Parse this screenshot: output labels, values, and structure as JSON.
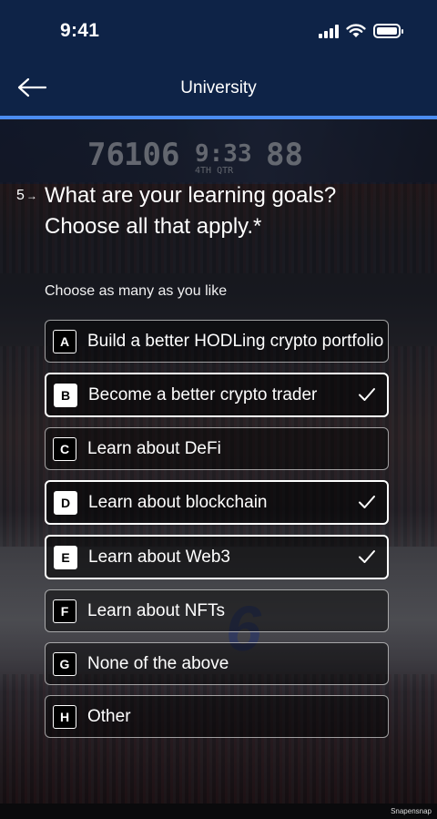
{
  "status_bar": {
    "time": "9:41"
  },
  "header": {
    "title": "University",
    "back_icon": "arrow-left-icon"
  },
  "progress": {
    "fraction": 1.0,
    "color": "#4b8cf0"
  },
  "background": {
    "scores": [
      "76",
      "106",
      "9:33",
      "88"
    ],
    "quarter": "4TH QTR"
  },
  "question": {
    "number": "5",
    "text": "What are your learning goals? Choose all that apply.*",
    "subtitle": "Choose as many as you like"
  },
  "options": [
    {
      "key": "A",
      "label": "Build a better HODLing crypto portfolio",
      "selected": false
    },
    {
      "key": "B",
      "label": "Become a better crypto trader",
      "selected": true
    },
    {
      "key": "C",
      "label": "Learn about DeFi",
      "selected": false
    },
    {
      "key": "D",
      "label": "Learn about blockchain",
      "selected": true
    },
    {
      "key": "E",
      "label": "Learn about Web3",
      "selected": true
    },
    {
      "key": "F",
      "label": "Learn about NFTs",
      "selected": false
    },
    {
      "key": "G",
      "label": "None of the above",
      "selected": false
    },
    {
      "key": "H",
      "label": "Other",
      "selected": false
    }
  ],
  "watermark": "Snapensnap",
  "colors": {
    "header_bg": "#0e2347",
    "accent": "#4b8cf0"
  }
}
